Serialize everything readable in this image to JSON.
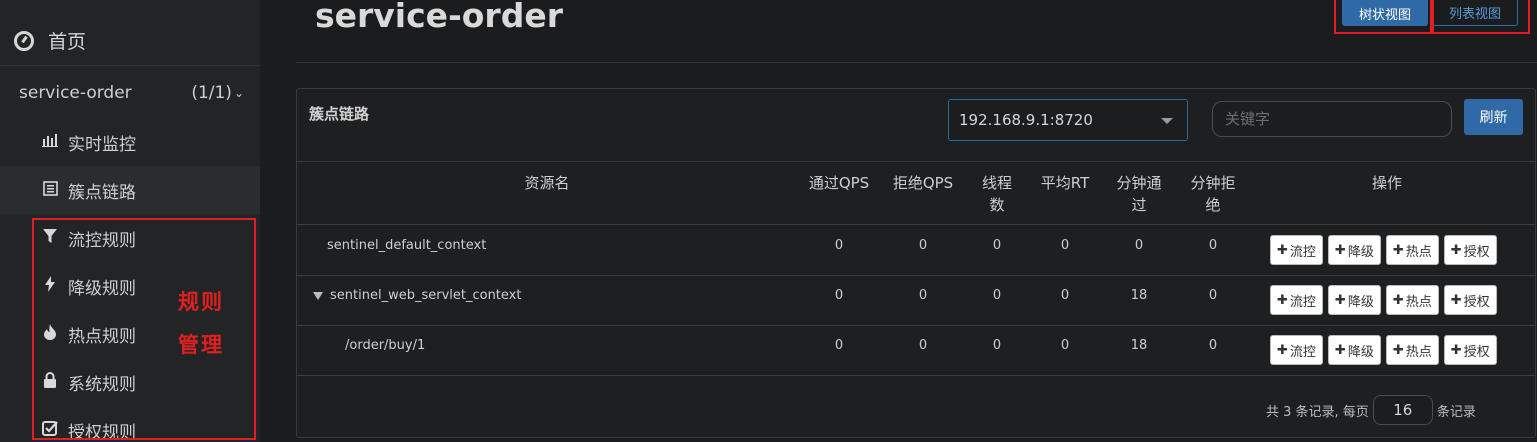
{
  "sidebar": {
    "home": "首页",
    "app": {
      "name": "service-order",
      "count": "(1/1)"
    },
    "items": [
      {
        "label": "实时监控",
        "icon": "bar-chart-icon"
      },
      {
        "label": "簇点链路",
        "icon": "list-icon"
      },
      {
        "label": "流控规则",
        "icon": "filter-icon"
      },
      {
        "label": "降级规则",
        "icon": "bolt-icon"
      },
      {
        "label": "热点规则",
        "icon": "fire-icon"
      },
      {
        "label": "系统规则",
        "icon": "lock-icon"
      },
      {
        "label": "授权规则",
        "icon": "check-square-icon"
      }
    ],
    "annotation": [
      "规则",
      "管理"
    ]
  },
  "header": {
    "title": "service-order",
    "tree_view": "树状视图",
    "list_view": "列表视图"
  },
  "panel": {
    "title": "簇点链路",
    "machine": "192.168.9.1:8720",
    "search_placeholder": "关键字",
    "refresh": "刷新",
    "columns": [
      "资源名",
      "通过QPS",
      "拒绝QPS",
      "线程数",
      "平均RT",
      "分钟通过",
      "分钟拒绝",
      "操作"
    ],
    "rows": [
      {
        "name": "sentinel_default_context",
        "pass_qps": "0",
        "block_qps": "0",
        "threads": "0",
        "avg_rt": "0",
        "min_pass": "0",
        "min_block": "0"
      },
      {
        "name": "sentinel_web_servlet_context",
        "pass_qps": "0",
        "block_qps": "0",
        "threads": "0",
        "avg_rt": "0",
        "min_pass": "18",
        "min_block": "0"
      },
      {
        "name": "/order/buy/1",
        "pass_qps": "0",
        "block_qps": "0",
        "threads": "0",
        "avg_rt": "0",
        "min_pass": "18",
        "min_block": "0"
      }
    ],
    "ops": [
      "流控",
      "降级",
      "热点",
      "授权"
    ],
    "pager": {
      "prefix": "共 3 条记录, 每页",
      "page_size": "16",
      "suffix": "条记录"
    }
  },
  "colors": {
    "accent": "#2f6aa6",
    "highlight": "#e02020"
  }
}
